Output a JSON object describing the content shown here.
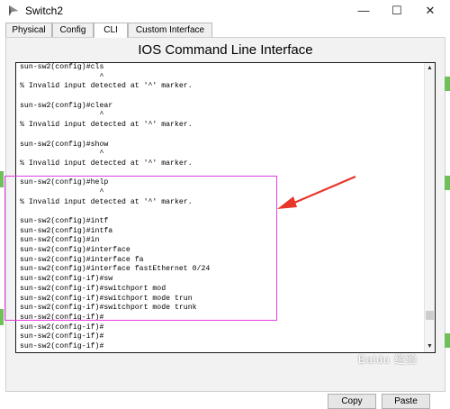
{
  "window": {
    "title": "Switch2",
    "buttons": {
      "minimize": "—",
      "maximize": "☐",
      "close": "✕"
    }
  },
  "tabs": [
    {
      "label": "Physical"
    },
    {
      "label": "Config"
    },
    {
      "label": "CLI"
    },
    {
      "label": "Custom Interface"
    }
  ],
  "active_tab": "CLI",
  "heading": "IOS Command Line Interface",
  "terminal": {
    "lines": [
      "sun-sw2(config)#cls",
      "                  ^",
      "% Invalid input detected at '^' marker.",
      "",
      "sun-sw2(config)#clear",
      "                  ^",
      "% Invalid input detected at '^' marker.",
      "",
      "sun-sw2(config)#show",
      "                  ^",
      "% Invalid input detected at '^' marker.",
      "",
      "sun-sw2(config)#help",
      "                  ^",
      "% Invalid input detected at '^' marker.",
      "",
      "sun-sw2(config)#intf",
      "sun-sw2(config)#intfa",
      "sun-sw2(config)#in",
      "sun-sw2(config)#interface",
      "sun-sw2(config)#interface fa",
      "sun-sw2(config)#interface fastEthernet 0/24",
      "sun-sw2(config-if)#sw",
      "sun-sw2(config-if)#switchport mod",
      "sun-sw2(config-if)#switchport mode trun",
      "sun-sw2(config-if)#switchport mode trunk",
      "sun-sw2(config-if)#",
      "sun-sw2(config-if)#",
      "sun-sw2(config-if)#",
      "sun-sw2(config-if)#"
    ]
  },
  "buttons": {
    "copy": "Copy",
    "paste": "Paste"
  },
  "watermark": "Baidu 经验",
  "colors": {
    "highlight": "#e23ce2",
    "arrow": "#e8362a"
  }
}
